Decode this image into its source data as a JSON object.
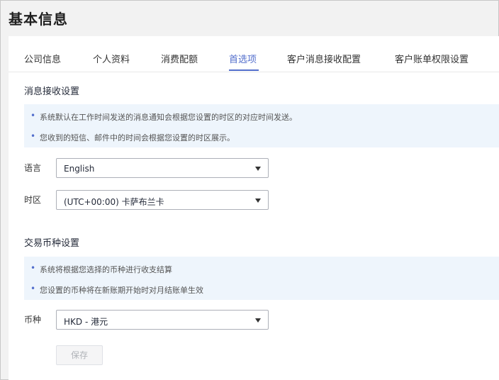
{
  "page": {
    "title": "基本信息"
  },
  "tabs": [
    {
      "label": "公司信息",
      "active": false
    },
    {
      "label": "个人资料",
      "active": false
    },
    {
      "label": "消费配额",
      "active": false
    },
    {
      "label": "首选项",
      "active": true
    },
    {
      "label": "客户消息接收配置",
      "active": false
    },
    {
      "label": "客户账单权限设置",
      "active": false
    }
  ],
  "message_section": {
    "title": "消息接收设置",
    "notices": [
      "系统默认在工作时间发送的消息通知会根据您设置的时区的对应时间发送。",
      "您收到的短信、邮件中的时间会根据您设置的时区展示。"
    ],
    "language": {
      "label": "语言",
      "value": "English"
    },
    "timezone": {
      "label": "时区",
      "value": "(UTC+00:00) 卡萨布兰卡"
    }
  },
  "currency_section": {
    "title": "交易币种设置",
    "notices": [
      "系统将根据您选择的币种进行收支结算",
      "您设置的币种将在新账期开始时对月结账单生效"
    ],
    "currency": {
      "label": "币种",
      "value": "HKD - 港元"
    }
  },
  "actions": {
    "save_label": "保存",
    "save_enabled": false
  },
  "colors": {
    "accent": "#526ecc",
    "notice_bg": "#eef5fc"
  }
}
